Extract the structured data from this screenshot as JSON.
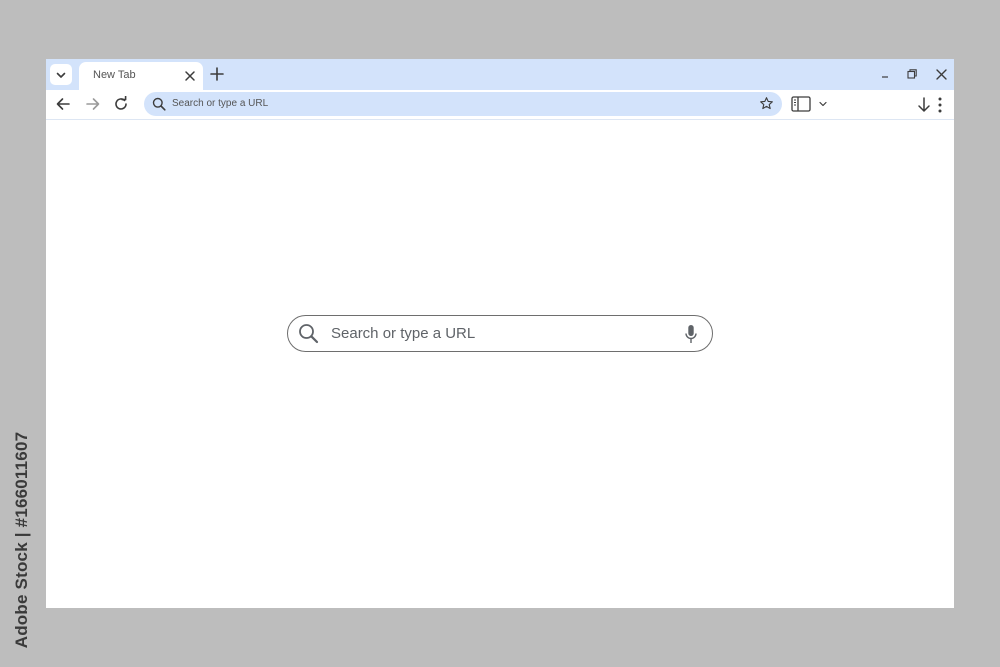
{
  "tab": {
    "title": "New Tab"
  },
  "omnibox": {
    "placeholder": "Search or type a URL"
  },
  "ntp": {
    "search_placeholder": "Search or type a URL"
  },
  "watermark": {
    "text": "Adobe Stock | #166011607"
  },
  "colors": {
    "tabstrip": "#d3e3fb",
    "background": "#bdbdbd",
    "page": "#ffffff"
  },
  "icons": {
    "tab_list": "chevron-down-icon",
    "tab_close": "close-icon",
    "new_tab": "plus-icon",
    "minimize": "minimize-icon",
    "restore": "restore-icon",
    "close_window": "close-icon",
    "back": "arrow-left-icon",
    "forward": "arrow-right-icon",
    "reload": "reload-icon",
    "search": "search-icon",
    "bookmark": "star-icon",
    "side_panel": "side-panel-icon",
    "downloads": "download-icon",
    "menu": "kebab-menu-icon",
    "voice": "microphone-icon"
  }
}
